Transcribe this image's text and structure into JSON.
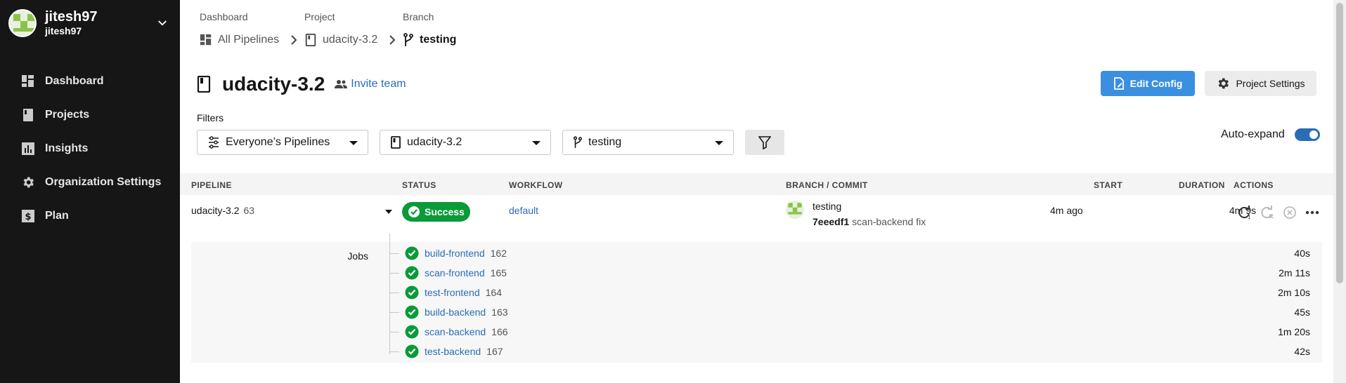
{
  "user": {
    "name": "jitesh97",
    "handle": "jitesh97"
  },
  "nav": [
    {
      "label": "Dashboard",
      "icon": "dashboard-icon"
    },
    {
      "label": "Projects",
      "icon": "book-icon"
    },
    {
      "label": "Insights",
      "icon": "chart-icon"
    },
    {
      "label": "Organization Settings",
      "icon": "gear-icon"
    },
    {
      "label": "Plan",
      "icon": "dollar-icon"
    }
  ],
  "breadcrumb": {
    "labels": [
      "Dashboard",
      "Project",
      "Branch"
    ],
    "items": [
      "All Pipelines",
      "udacity-3.2",
      "testing"
    ]
  },
  "header": {
    "title": "udacity-3.2",
    "invite": "Invite team",
    "edit_config": "Edit Config",
    "project_settings": "Project Settings"
  },
  "filters": {
    "label": "Filters",
    "pipelines": "Everyone’s Pipelines",
    "project": "udacity-3.2",
    "branch": "testing",
    "auto_expand": "Auto-expand",
    "auto_expand_on": true
  },
  "table": {
    "columns": [
      "PIPELINE",
      "STATUS",
      "WORKFLOW",
      "BRANCH / COMMIT",
      "START",
      "DURATION",
      "ACTIONS"
    ],
    "row": {
      "pipeline": "udacity-3.2",
      "number": "63",
      "status": "Success",
      "workflow": "default",
      "branch": "testing",
      "commit_hash": "7eeedf1",
      "commit_msg": "scan-backend fix",
      "start": "4m ago",
      "duration": "4m 9s"
    },
    "jobs_label": "Jobs",
    "jobs": [
      {
        "name": "build-frontend",
        "num": "162",
        "dur": "40s"
      },
      {
        "name": "scan-frontend",
        "num": "165",
        "dur": "2m 11s"
      },
      {
        "name": "test-frontend",
        "num": "164",
        "dur": "2m 10s"
      },
      {
        "name": "build-backend",
        "num": "163",
        "dur": "45s"
      },
      {
        "name": "scan-backend",
        "num": "166",
        "dur": "1m 20s"
      },
      {
        "name": "test-backend",
        "num": "167",
        "dur": "42s"
      }
    ]
  },
  "colors": {
    "success": "#0a9b38",
    "link": "#2a6db5",
    "sidebar": "#161616",
    "primary_button": "#3b8fe0"
  }
}
